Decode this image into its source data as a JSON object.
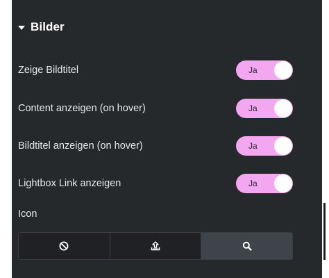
{
  "section": {
    "title": "Bilder",
    "caret_icon": "caret-down-icon"
  },
  "settings": [
    {
      "label": "Zeige Bildtitel",
      "value": "Ja",
      "on": true
    },
    {
      "label": "Content anzeigen (on hover)",
      "value": "Ja",
      "on": true
    },
    {
      "label": "Bildtitel anzeigen (on hover)",
      "value": "Ja",
      "on": true
    },
    {
      "label": "Lightbox Link anzeigen",
      "value": "Ja",
      "on": true
    }
  ],
  "icon_choice": {
    "label": "Icon",
    "options": [
      {
        "icon": "ban-icon",
        "selected": false
      },
      {
        "icon": "upload-icon",
        "selected": false
      },
      {
        "icon": "search-icon",
        "selected": true
      }
    ]
  },
  "colors": {
    "panel_bg": "#26292c",
    "toggle_on": "#f2a7f0",
    "segment_active": "#3f444b"
  }
}
